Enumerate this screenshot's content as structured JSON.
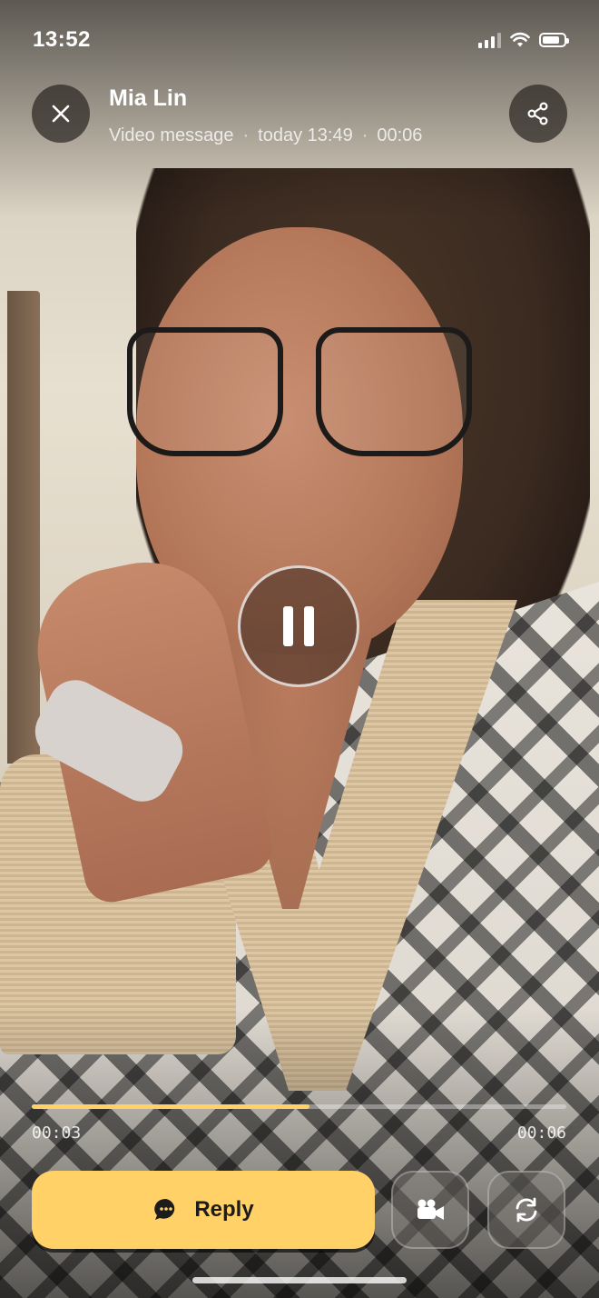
{
  "status_bar": {
    "time": "13:52",
    "battery_level": 0.85
  },
  "header": {
    "sender_name": "Mia Lin",
    "message_type": "Video message",
    "separator": "·",
    "sent_time": "today 13:49",
    "duration": "00:06",
    "close_icon": "close-icon",
    "share_icon": "share-icon"
  },
  "player": {
    "state": "playing",
    "pause_icon": "pause-icon",
    "current_time": "00:03",
    "total_time": "00:06",
    "progress": 0.52
  },
  "actions": {
    "reply_label": "Reply",
    "reply_icon": "chat-bubble-icon",
    "video_reply_icon": "video-camera-icon",
    "replay_icon": "refresh-icon"
  },
  "colors": {
    "accent": "#ffd166",
    "text_primary": "#ffffff",
    "reply_text": "#1c1c1c"
  }
}
